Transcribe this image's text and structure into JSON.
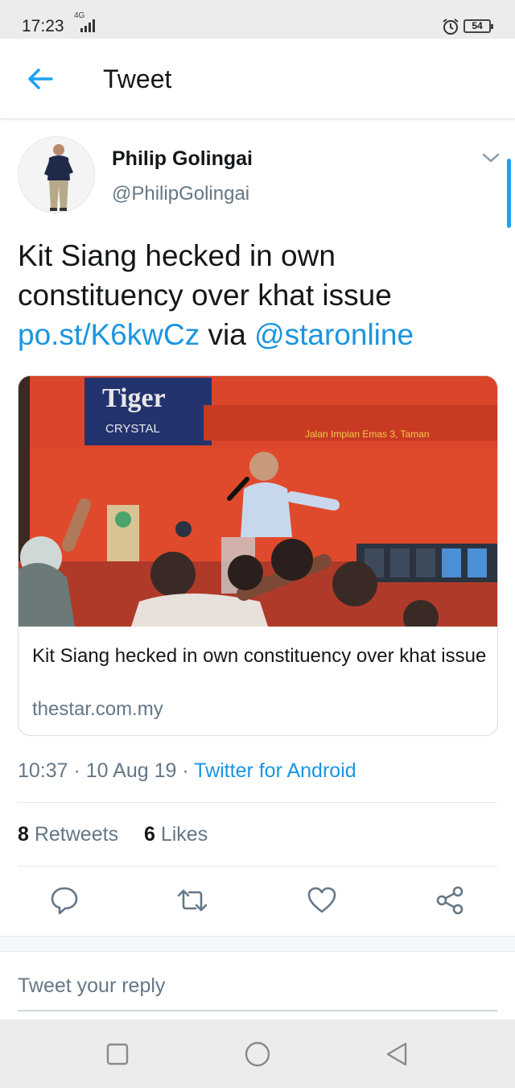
{
  "status": {
    "time": "17:23",
    "network": "4G",
    "battery": "54"
  },
  "appbar": {
    "title": "Tweet"
  },
  "tweet": {
    "author_name": "Philip Golingai",
    "author_handle": "@PhilipGolingai",
    "text_plain": "Kit Siang hecked in own constituency over khat issue ",
    "link": "po.st/K6kwCz",
    "via": " via ",
    "mention": "@staronline",
    "card": {
      "banner_brand": "Tiger",
      "banner_sub": "CRYSTAL",
      "banner_address": "Jalan Impian Emas 3, Taman",
      "title": "Kit Siang hecked in own constituency over khat issue",
      "domain": "thestar.com.my"
    },
    "time": "10:37",
    "date": "10 Aug 19",
    "separator": " · ",
    "source": "Twitter for Android",
    "retweets_count": "8",
    "retweets_label": " Retweets",
    "likes_count": "6",
    "likes_label": " Likes"
  },
  "icons": {
    "back": "arrow-left-icon",
    "menu": "chevron-down-icon",
    "reply": "comment-icon",
    "retweet": "retweet-icon",
    "like": "heart-icon",
    "share": "share-icon"
  },
  "reply_box": {
    "placeholder": "Tweet your reply"
  },
  "colors": {
    "accent": "#1da1f2",
    "link": "#1b95e0",
    "muted": "#657786"
  }
}
